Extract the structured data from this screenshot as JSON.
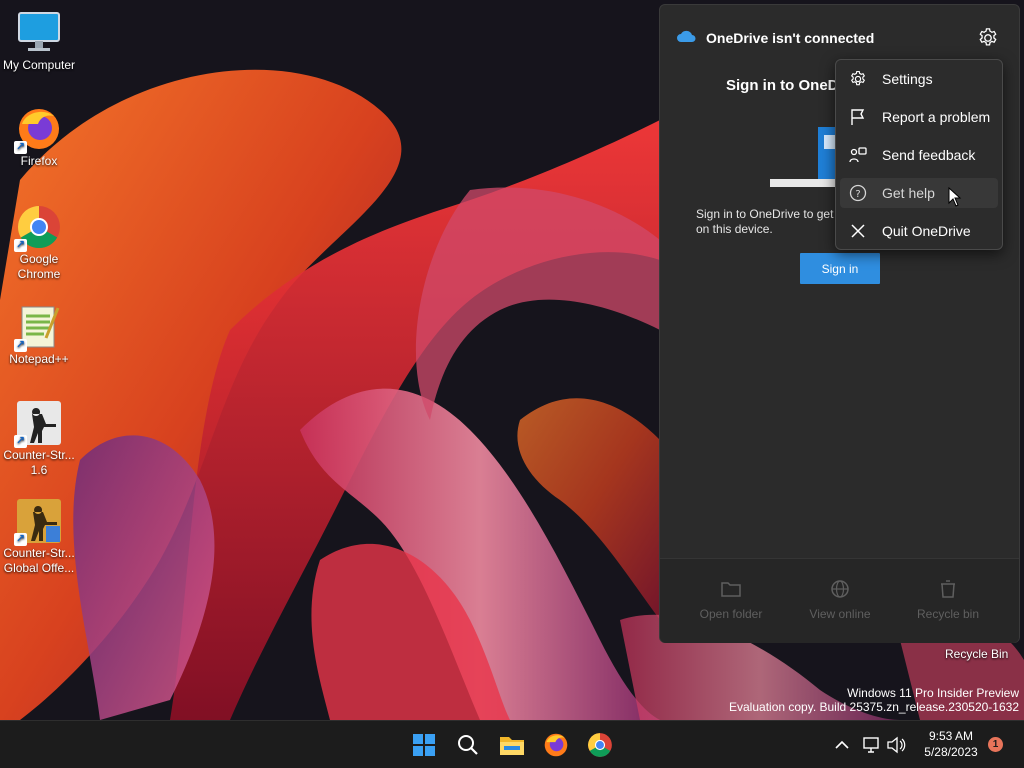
{
  "desktop": {
    "icons": [
      {
        "label": "My Computer",
        "icon": "monitor-icon"
      },
      {
        "label": "Firefox",
        "icon": "firefox-icon"
      },
      {
        "label": "Google Chrome",
        "icon": "chrome-icon"
      },
      {
        "label": "Notepad++",
        "icon": "notepadpp-icon"
      },
      {
        "label": "Counter-Str... 1.6",
        "icon": "counter-strike-icon"
      },
      {
        "label": "Counter-Str... Global Offe...",
        "icon": "csgo-icon"
      }
    ],
    "recycle_bin_label": "Recycle Bin",
    "watermark": {
      "line1": "Windows 11 Pro Insider Preview",
      "line2": "Evaluation copy. Build 25375.zn_release.230520-1632"
    }
  },
  "onedrive": {
    "title": "OneDrive isn't connected",
    "signin_heading": "Sign in to OneD",
    "description": "Sign in to OneDrive to get on this device.",
    "signin_button": "Sign in",
    "footer": [
      {
        "label": "Open folder",
        "icon": "folder-icon"
      },
      {
        "label": "View online",
        "icon": "globe-icon"
      },
      {
        "label": "Recycle bin",
        "icon": "trash-icon"
      }
    ],
    "menu": [
      {
        "label": "Settings",
        "icon": "gear-icon"
      },
      {
        "label": "Report a problem",
        "icon": "flag-icon"
      },
      {
        "label": "Send feedback",
        "icon": "feedback-icon"
      },
      {
        "label": "Get help",
        "icon": "help-icon",
        "hovered": true
      },
      {
        "label": "Quit OneDrive",
        "icon": "close-icon"
      }
    ]
  },
  "taskbar": {
    "apps": [
      "start-icon",
      "search-icon",
      "file-explorer-icon",
      "firefox-icon",
      "chrome-icon"
    ],
    "clock_time": "9:53 AM",
    "clock_date": "5/28/2023",
    "notification_count": "1"
  },
  "colors": {
    "accent": "#2f8ee0",
    "panel_bg": "#2b2b2b",
    "menu_bg": "#2c2c2c",
    "taskbar_bg": "#1c1c1c"
  }
}
